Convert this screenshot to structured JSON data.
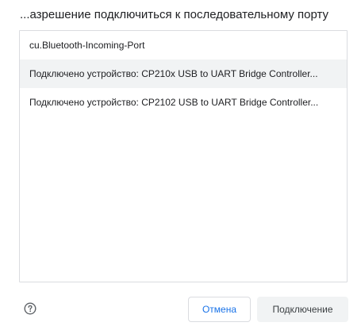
{
  "dialog": {
    "title": "...азрешение подключиться к последовательному порту",
    "devices": [
      {
        "label": "cu.Bluetooth-Incoming-Port",
        "selected": false
      },
      {
        "label": "Подключено устройство: CP210x USB to UART Bridge Controller...",
        "selected": true
      },
      {
        "label": "Подключено устройство: CP2102 USB to UART Bridge Controller...",
        "selected": false
      }
    ],
    "help_icon": "question-circle-icon",
    "cancel_label": "Отмена",
    "connect_label": "Подключение"
  },
  "colors": {
    "accent": "#1a73e8",
    "selected_row_bg": "#f1f3f4",
    "border": "#dadce0"
  }
}
